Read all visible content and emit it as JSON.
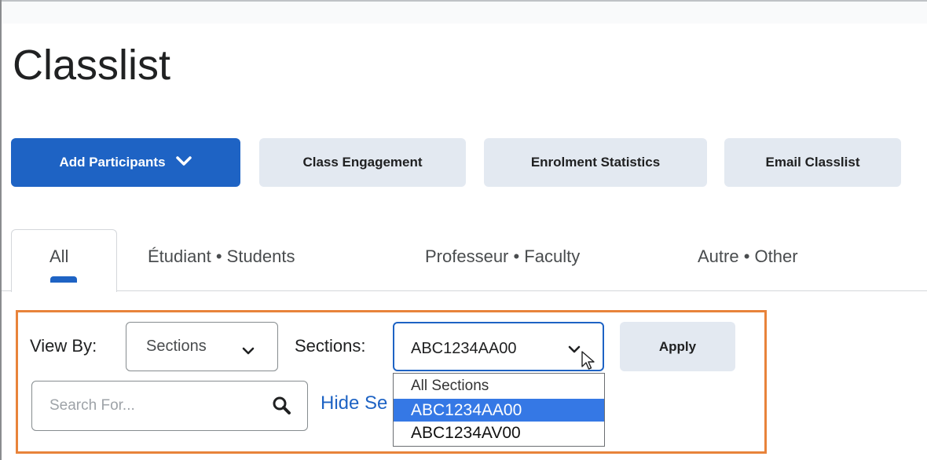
{
  "page": {
    "title": "Classlist"
  },
  "toolbar": {
    "add_participants": "Add Participants",
    "class_engagement": "Class Engagement",
    "enrolment_statistics": "Enrolment Statistics",
    "email_classlist": "Email Classlist"
  },
  "tabs": [
    {
      "label": "All",
      "active": true
    },
    {
      "label": "Étudiant • Students",
      "active": false
    },
    {
      "label": "Professeur • Faculty",
      "active": false
    },
    {
      "label": "Autre • Other",
      "active": false
    }
  ],
  "filters": {
    "view_by_label": "View By:",
    "view_by_value": "Sections",
    "sections_label": "Sections:",
    "sections_value": "ABC1234AA00",
    "apply_label": "Apply",
    "search_placeholder": "Search For...",
    "hide_link": "Hide Se",
    "section_options": [
      {
        "label": "All Sections",
        "selected": false
      },
      {
        "label": "ABC1234AA00",
        "selected": true
      },
      {
        "label": "ABC1234AV00",
        "selected": false
      }
    ]
  },
  "colors": {
    "primary": "#1e63c4",
    "secondary_button": "#e3e9f1",
    "highlight_border": "#e8833a",
    "option_selected": "#3578e5"
  },
  "icons": {
    "add_participants_chevron": "chevron-down-icon",
    "search": "search-icon",
    "select_chevron": "chevron-down-icon",
    "cursor": "mouse-pointer-icon"
  }
}
